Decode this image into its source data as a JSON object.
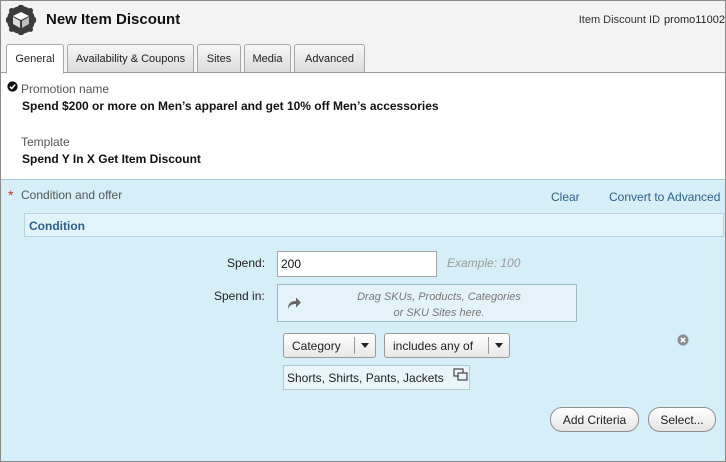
{
  "header": {
    "title": "New Item Discount",
    "item_id_label": "Item Discount ID",
    "item_id_value": "promo11002"
  },
  "tabs": [
    {
      "label": "General",
      "active": true
    },
    {
      "label": "Availability & Coupons",
      "active": false
    },
    {
      "label": "Sites",
      "active": false
    },
    {
      "label": "Media",
      "active": false
    },
    {
      "label": "Advanced",
      "active": false
    }
  ],
  "general": {
    "promotion_name_label": "Promotion name",
    "promotion_name_value": "Spend $200 or more on Men’s apparel and get 10% off Men’s accessories",
    "template_label": "Template",
    "template_value": "Spend Y In X Get Item Discount"
  },
  "condition_offer": {
    "required_marker": "*",
    "title": "Condition and offer",
    "clear_link": "Clear",
    "convert_link": "Convert to Advanced",
    "condition_header": "Condition",
    "spend_label": "Spend:",
    "spend_value": "200",
    "spend_example": "Example: 100",
    "spend_in_label": "Spend in:",
    "drop_hint_line1": "Drag SKUs, Products, Categories",
    "drop_hint_line2": "or SKU Sites here.",
    "criteria_select": "Category",
    "operator_select": "includes any of",
    "values": "Shorts, Shirts, Pants, Jackets",
    "add_criteria_button": "Add Criteria",
    "select_button": "Select..."
  },
  "icons": {
    "logo": "promotion-box-icon",
    "check": "check-circle-icon",
    "drop": "drag-arrow-icon",
    "remove": "remove-circle-icon",
    "popout": "popout-window-icon"
  },
  "colors": {
    "panel_bg": "#d6eef8",
    "link": "#2d5f8a",
    "required": "#c0392b"
  }
}
